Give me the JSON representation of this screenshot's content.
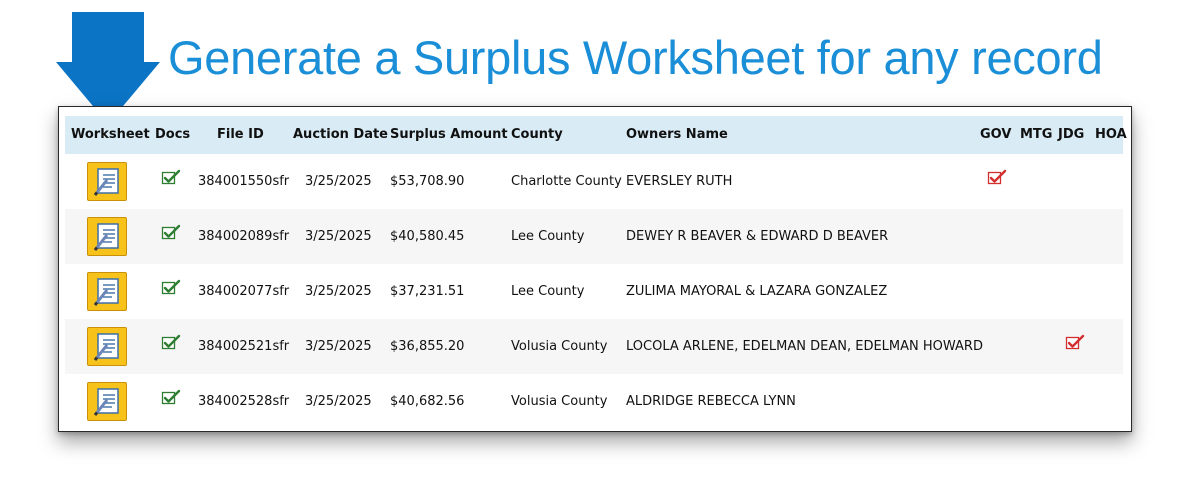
{
  "headline": "Generate a Surplus Worksheet for any record",
  "colors": {
    "accent": "#1a8fd8",
    "worksheet_button": "#f7c21a",
    "doc_check": "#2e7d32",
    "flag_check": "#d32f2f",
    "header_bg": "#d9ecf6"
  },
  "icons": {
    "pointer": "down-arrow-icon",
    "worksheet": "worksheet-icon",
    "docs": "green-checkbox-icon",
    "flag": "red-checkbox-icon"
  },
  "table": {
    "columns": {
      "worksheet": "Worksheet",
      "docs": "Docs",
      "file_id": "File ID",
      "auction_date": "Auction Date",
      "surplus_amount": "Surplus Amount",
      "county": "County",
      "owners_name": "Owners Name",
      "gov": "GOV",
      "mtg": "MTG",
      "jdg": "JDG",
      "hoa": "HOA"
    },
    "rows": [
      {
        "file_id": "384001550sfr",
        "auction_date": "3/25/2025",
        "surplus_amount": "$53,708.90",
        "county": "Charlotte County",
        "owners_name": "EVERSLEY RUTH",
        "docs": true,
        "gov": true,
        "mtg": false,
        "jdg": false,
        "hoa": false
      },
      {
        "file_id": "384002089sfr",
        "auction_date": "3/25/2025",
        "surplus_amount": "$40,580.45",
        "county": "Lee County",
        "owners_name": "DEWEY R BEAVER & EDWARD D BEAVER",
        "docs": true,
        "gov": false,
        "mtg": false,
        "jdg": false,
        "hoa": false
      },
      {
        "file_id": "384002077sfr",
        "auction_date": "3/25/2025",
        "surplus_amount": "$37,231.51",
        "county": "Lee County",
        "owners_name": "ZULIMA MAYORAL & LAZARA GONZALEZ",
        "docs": true,
        "gov": false,
        "mtg": false,
        "jdg": false,
        "hoa": false
      },
      {
        "file_id": "384002521sfr",
        "auction_date": "3/25/2025",
        "surplus_amount": "$36,855.20",
        "county": "Volusia County",
        "owners_name": "LOCOLA ARLENE, EDELMAN DEAN, EDELMAN HOWARD",
        "docs": true,
        "gov": false,
        "mtg": false,
        "jdg": true,
        "hoa": false
      },
      {
        "file_id": "384002528sfr",
        "auction_date": "3/25/2025",
        "surplus_amount": "$40,682.56",
        "county": "Volusia County",
        "owners_name": "ALDRIDGE REBECCA LYNN",
        "docs": true,
        "gov": false,
        "mtg": false,
        "jdg": false,
        "hoa": false
      }
    ]
  }
}
